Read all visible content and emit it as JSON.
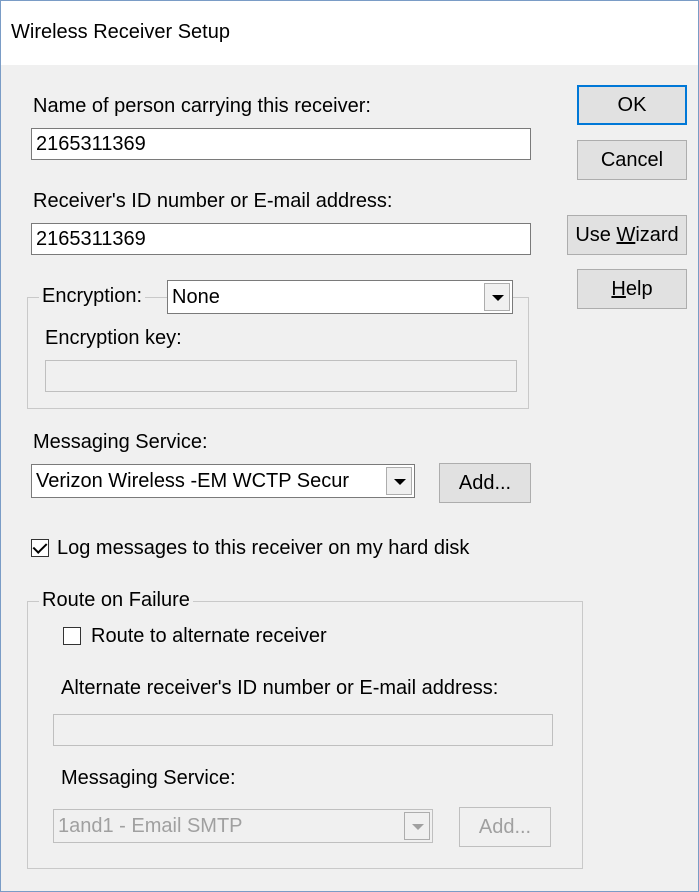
{
  "window": {
    "title": "Wireless Receiver Setup"
  },
  "form": {
    "name_label": "Name of person carrying this receiver:",
    "name_value": "2165311369",
    "id_label": "Receiver's ID number or E-mail address:",
    "id_value": "2165311369",
    "encryption_label": "Encryption:",
    "encryption_value": "None",
    "encryption_key_label": "Encryption key:",
    "encryption_key_value": "",
    "messaging_service_label": "Messaging Service:",
    "messaging_service_value": "Verizon Wireless -EM WCTP Secur",
    "add_button": "Add...",
    "log_checkbox_label": "Log messages to this receiver on my hard disk",
    "log_checked": true
  },
  "route_on_failure": {
    "group_label": "Route on Failure",
    "route_checkbox_label": "Route to alternate receiver",
    "route_checked": false,
    "alt_id_label": "Alternate receiver's ID number or E-mail address:",
    "alt_id_value": "",
    "alt_messaging_label": "Messaging Service:",
    "alt_messaging_value": "1and1 - Email SMTP",
    "alt_add_button": "Add..."
  },
  "buttons": {
    "ok": "OK",
    "cancel": "Cancel",
    "use_wizard_prefix": "Use ",
    "use_wizard_mnemonic": "W",
    "use_wizard_rest": "izard",
    "help_mnemonic": "H",
    "help_rest": "elp"
  }
}
